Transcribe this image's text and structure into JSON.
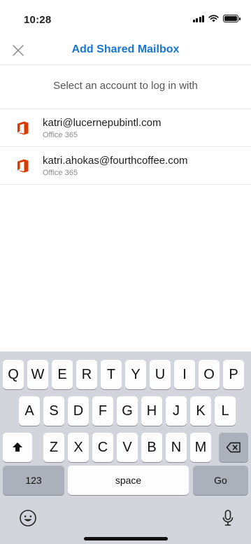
{
  "status_bar": {
    "time": "10:28",
    "icons": [
      "signal-icon",
      "wifi-icon",
      "battery-icon"
    ]
  },
  "nav": {
    "title": "Add Shared Mailbox",
    "close_icon": "close-icon"
  },
  "prompt": "Select an account to log in with",
  "accounts": [
    {
      "email": "katri@lucernepubintl.com",
      "type": "Office 365",
      "icon": "office-365-icon"
    },
    {
      "email": "katri.ahokas@fourthcoffee.com",
      "type": "Office 365",
      "icon": "office-365-icon"
    }
  ],
  "keyboard": {
    "row1": [
      "Q",
      "W",
      "E",
      "R",
      "T",
      "Y",
      "U",
      "I",
      "O",
      "P"
    ],
    "row2": [
      "A",
      "S",
      "D",
      "F",
      "G",
      "H",
      "J",
      "K",
      "L"
    ],
    "row3": [
      "Z",
      "X",
      "C",
      "V",
      "B",
      "N",
      "M"
    ],
    "numbers_label": "123",
    "space_label": "space",
    "go_label": "Go"
  },
  "colors": {
    "accent": "#1976d2",
    "office_red": "#d83b01",
    "keyboard_bg": "#d2d5db"
  }
}
